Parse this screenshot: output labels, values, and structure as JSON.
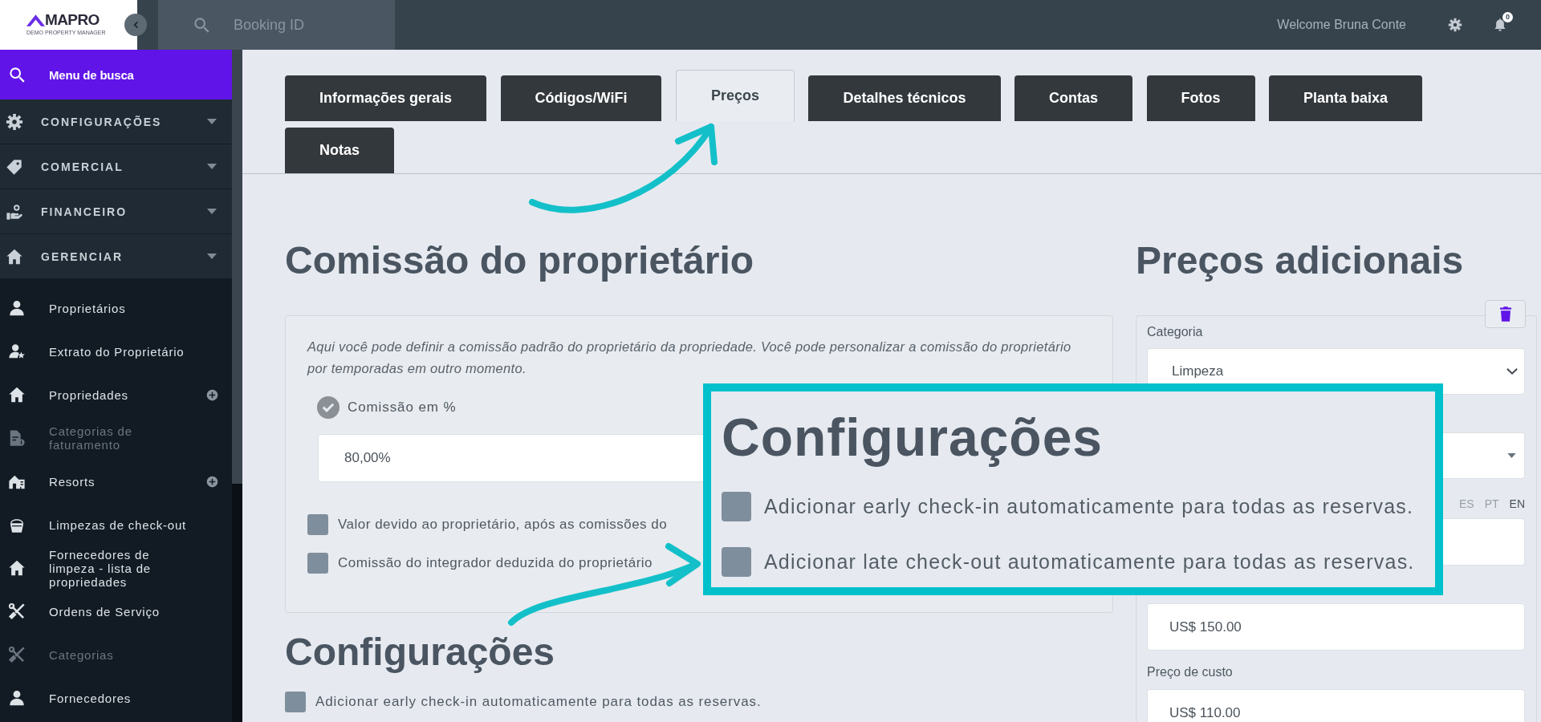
{
  "topbar": {
    "logo": {
      "name": "MAPRO",
      "tagline": "DEMO PROPERTY MANAGER"
    },
    "search": {
      "placeholder": "Booking ID"
    },
    "greeting": "Welcome Bruna Conte",
    "notification_count": "0"
  },
  "sidebar": {
    "search_item": {
      "label": "Menu de busca",
      "selected": true
    },
    "sections": [
      {
        "label": "CONFIGURAÇÕES",
        "selected": false
      },
      {
        "label": "COMERCIAL",
        "selected": false
      },
      {
        "label": "FINANCEIRO",
        "selected": false
      },
      {
        "label": "GERENCIAR",
        "selected": false,
        "children": [
          {
            "label": "Proprietários",
            "selected": false,
            "disabled": false,
            "add_button": false
          },
          {
            "label": "Extrato do Proprietário",
            "selected": false,
            "disabled": false,
            "add_button": false
          },
          {
            "label": "Propriedades",
            "selected": false,
            "disabled": false,
            "add_button": true
          },
          {
            "label": "Categorias de faturamento",
            "selected": false,
            "disabled": true,
            "add_button": false
          },
          {
            "label": "Resorts",
            "selected": false,
            "disabled": false,
            "add_button": true
          },
          {
            "label": "Limpezas de check-out",
            "selected": false,
            "disabled": false,
            "add_button": false
          },
          {
            "label": "Fornecedores de limpeza - lista de propriedades",
            "selected": false,
            "disabled": false,
            "add_button": false
          },
          {
            "label": "Ordens de Serviço",
            "selected": false,
            "disabled": false,
            "add_button": false
          },
          {
            "label": "Categorias",
            "selected": false,
            "disabled": true,
            "add_button": false
          },
          {
            "label": "Fornecedores",
            "selected": false,
            "disabled": false,
            "add_button": false
          }
        ]
      }
    ]
  },
  "tabs": [
    {
      "label": "Informações gerais",
      "selected": false
    },
    {
      "label": "Códigos/WiFi",
      "selected": false
    },
    {
      "label": "Preços",
      "selected": true
    },
    {
      "label": "Detalhes técnicos",
      "selected": false
    },
    {
      "label": "Contas",
      "selected": false
    },
    {
      "label": "Fotos",
      "selected": false
    },
    {
      "label": "Planta baixa",
      "selected": false
    },
    {
      "label": "Notas",
      "selected": false
    }
  ],
  "owner_commission": {
    "title": "Comissão do proprietário",
    "description": "Aqui você pode definir a comissão padrão do proprietário da propriedade. Você pode personalizar a comissão do proprietário por temporadas em outro momento.",
    "mode": {
      "label": "Comissão em %",
      "checked": true
    },
    "value": "80,00%",
    "options": [
      {
        "label": "Valor devido ao proprietário, após as comissões do",
        "checked": false
      },
      {
        "label": "Comissão do integrador deduzida do proprietário",
        "checked": false
      }
    ]
  },
  "callout": {
    "title": "Configurações",
    "options": [
      {
        "label": "Adicionar early check-in automaticamente para todas as reservas.",
        "checked": false
      },
      {
        "label": "Adicionar late check-out automaticamente para todas as reservas.",
        "checked": false
      }
    ]
  },
  "settings": {
    "title": "Configurações",
    "options": [
      {
        "label": "Adicionar early check-in automaticamente para todas as reservas.",
        "checked": false
      }
    ]
  },
  "additional_prices": {
    "title": "Preços adicionais",
    "category": {
      "label": "Categoria",
      "value": "Limpeza"
    },
    "languages": [
      {
        "label": "ES",
        "selected": false
      },
      {
        "label": "PT",
        "selected": false
      },
      {
        "label": "EN",
        "selected": true
      }
    ],
    "price": {
      "value": "US$ 150.00"
    },
    "cost_price": {
      "label": "Preço de custo",
      "value": "US$ 110.00"
    }
  }
}
